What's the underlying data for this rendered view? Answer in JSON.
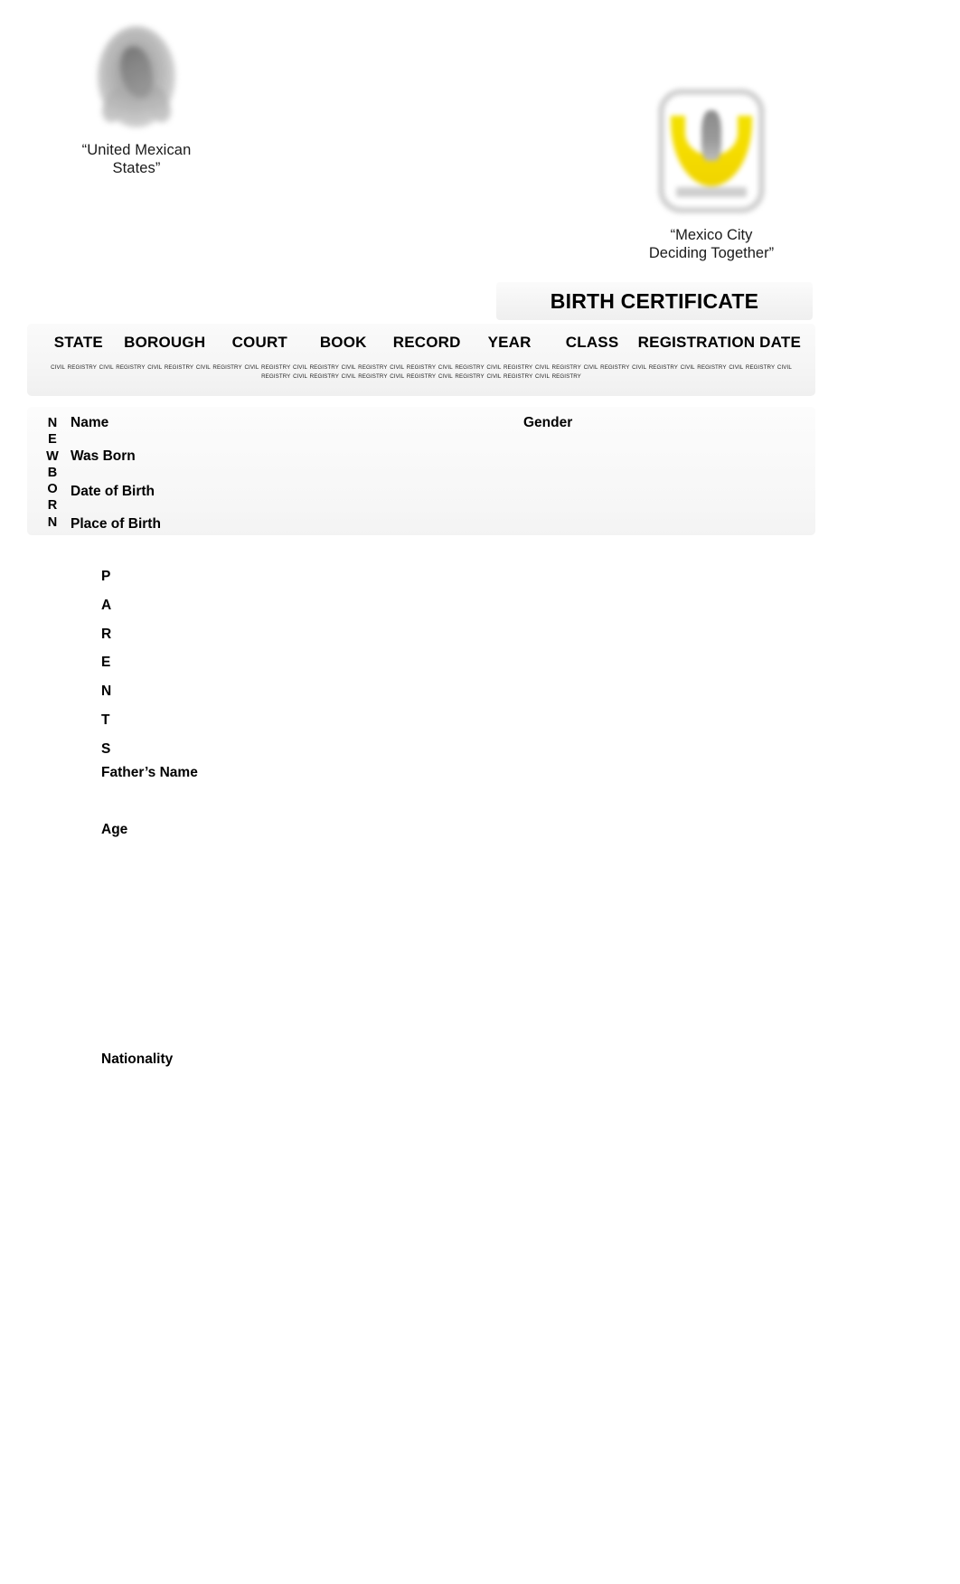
{
  "document": {
    "title": "BIRTH CERTIFICATE"
  },
  "header": {
    "national_emblem": {
      "icon": "mexican-coat-of-arms-icon",
      "caption": "“United Mexican\nStates”",
      "caption_line1": "“United Mexican",
      "caption_line2": "States”"
    },
    "city_logo": {
      "icon": "mexico-city-cdmx-logo-icon",
      "caption_line1": "“Mexico City",
      "caption_line2": "Deciding Together”",
      "accent_color": "#f2e100",
      "border_color": "#d2d2d2"
    }
  },
  "registry_table": {
    "columns": [
      {
        "label": "STATE"
      },
      {
        "label": "BOROUGH"
      },
      {
        "label": "COURT"
      },
      {
        "label": "BOOK"
      },
      {
        "label": "RECORD"
      },
      {
        "label": "YEAR"
      },
      {
        "label": "CLASS"
      },
      {
        "label": "REGISTRATION DATE"
      }
    ],
    "microtext_unit": "CIVIL REGISTRY",
    "microtext_repeat": 22
  },
  "newborn_section": {
    "side_label": "NEWBORN",
    "side_letters": [
      "N",
      "E",
      "W",
      "B",
      "O",
      "R",
      "N"
    ],
    "fields": [
      {
        "label": "Name",
        "value": ""
      },
      {
        "label": "Gender",
        "value": ""
      },
      {
        "label": "Was Born",
        "value": ""
      },
      {
        "label": "Date of Birth",
        "value": ""
      },
      {
        "label": "Place of Birth",
        "value": ""
      }
    ]
  },
  "parents_section": {
    "side_label": "PARENTS",
    "side_letters": [
      "P",
      "A",
      "R",
      "E",
      "N",
      "T",
      "S"
    ],
    "fields": [
      {
        "label": "Father’s Name",
        "value": ""
      },
      {
        "label": "Age",
        "value": ""
      },
      {
        "label": "Nationality",
        "value": ""
      }
    ]
  },
  "theme": {
    "background": "#ffffff",
    "text_color": "#000000",
    "panel_background": "#f5f5f5"
  }
}
